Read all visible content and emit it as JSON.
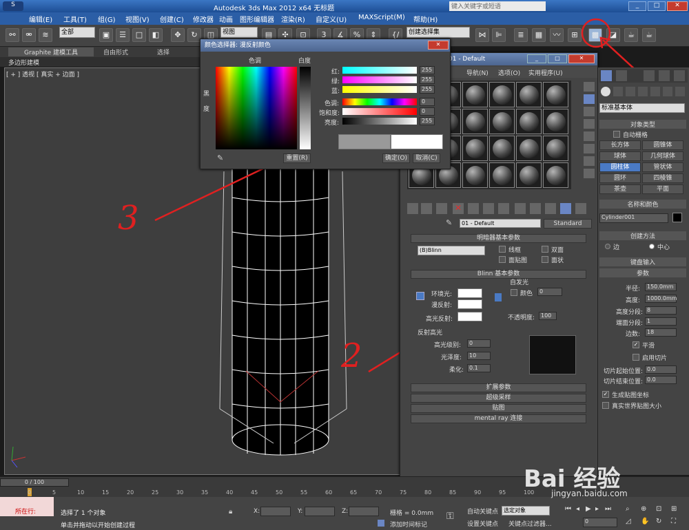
{
  "window": {
    "title": "Autodesk 3ds Max  2012 x64     无标题",
    "search_placeholder": "键入关键字或短语"
  },
  "menus": [
    "编辑(E)",
    "工具(T)",
    "组(G)",
    "视图(V)",
    "创建(C)",
    "修改器",
    "动画",
    "图形编辑器",
    "渲染(R)",
    "自定义(U)",
    "MAXScript(M)",
    "帮助(H)"
  ],
  "toolbar": {
    "filter": "全部",
    "refcoord": "视图",
    "named_sel": "创建选择集"
  },
  "ribbon": {
    "tabs": [
      "Graphite 建模工具",
      "自由形式",
      "选择"
    ],
    "sub": "多边形建模"
  },
  "viewport": {
    "label": "[ + ] 透视 [ 真实 + 边面 ]"
  },
  "color_picker": {
    "title": "颜色选择器: 漫反射颜色",
    "hue": "色调",
    "whiteness": "白度",
    "blackness": "黑",
    "degree": "度",
    "channels": [
      {
        "label": "红:",
        "value": "255"
      },
      {
        "label": "绿:",
        "value": "255"
      },
      {
        "label": "蓝:",
        "value": "255"
      },
      {
        "label": "色调:",
        "value": "0"
      },
      {
        "label": "饱和度:",
        "value": "0"
      },
      {
        "label": "亮度:",
        "value": "255"
      }
    ],
    "reset": "重置(R)",
    "ok": "确定(O)",
    "cancel": "取消(C)"
  },
  "material_editor": {
    "title": "01 - Default",
    "menus": [
      "导航(N)",
      "选项(O)",
      "实用程序(U)"
    ],
    "material_name": "01 - Default",
    "material_type": "Standard",
    "shader_rollout": "明暗器基本参数",
    "shader": "(B)Blinn",
    "wire": "线框",
    "two_sided": "双面",
    "face_map": "面贴图",
    "faceted": "面状",
    "blinn_rollout": "Blinn 基本参数",
    "self_illum": "自发光",
    "color": "颜色",
    "self_illum_value": "0",
    "ambient": "环境光:",
    "diffuse": "漫反射:",
    "specular": "高光反射:",
    "opacity": "不透明度:",
    "opacity_value": "100",
    "spec_group": "反射高光",
    "spec_level": "高光级别:",
    "spec_level_value": "0",
    "glossiness": "光泽度:",
    "glossiness_value": "10",
    "soften": "柔化:",
    "soften_value": "0.1",
    "rollouts": [
      "扩展参数",
      "超级采样",
      "贴图",
      "mental ray 连接"
    ]
  },
  "command_panel": {
    "category": "标准基本体",
    "object_type": "对象类型",
    "autogrid": "自动栅格",
    "buttons": [
      "长方体",
      "圆锥体",
      "球体",
      "几何球体",
      "圆柱体",
      "管状体",
      "圆环",
      "四棱锥",
      "茶壶",
      "平面"
    ],
    "name_color": "名称和颜色",
    "object_name": "Cylinder001",
    "creation_method": "创建方法",
    "edge": "边",
    "center": "中心",
    "keyboard_entry": "键盘输入",
    "parameters": "参数",
    "params": [
      {
        "label": "半径:",
        "value": "150.0mm"
      },
      {
        "label": "高度:",
        "value": "1000.0mm"
      },
      {
        "label": "高度分段:",
        "value": "8"
      },
      {
        "label": "端面分段:",
        "value": "1"
      },
      {
        "label": "边数:",
        "value": "18"
      }
    ],
    "smooth": "平滑",
    "slice_on": "启用切片",
    "slice_from": "切片起始位置:",
    "slice_from_value": "0.0",
    "slice_to": "切片结束位置:",
    "slice_to_value": "0.0",
    "gen_map": "生成贴图坐标",
    "real_world": "真实世界贴图大小"
  },
  "timeline": {
    "frame": "0 / 100",
    "ticks": [
      "0",
      "5",
      "10",
      "15",
      "20",
      "25",
      "30",
      "35",
      "40",
      "45",
      "50",
      "55",
      "60",
      "65",
      "70",
      "75",
      "80",
      "85",
      "90",
      "95",
      "100"
    ]
  },
  "status": {
    "running": "所在行:",
    "selected": "选择了 1 个对象",
    "prompt": "单击并拖动以开始创建过程",
    "x": "X:",
    "y": "Y:",
    "z": "Z:",
    "grid": "栅格 = 0.0mm",
    "add_time_tag": "添加时间标记",
    "auto_key": "自动关键点",
    "set_key": "设置关键点",
    "sel_obj": "选定对象",
    "key_filter": "关键点过滤器...",
    "frame_value": "0"
  },
  "annotations": [
    "3",
    "2"
  ],
  "watermark": "Bai 经验",
  "watermark_url": "jingyan.baidu.com"
}
